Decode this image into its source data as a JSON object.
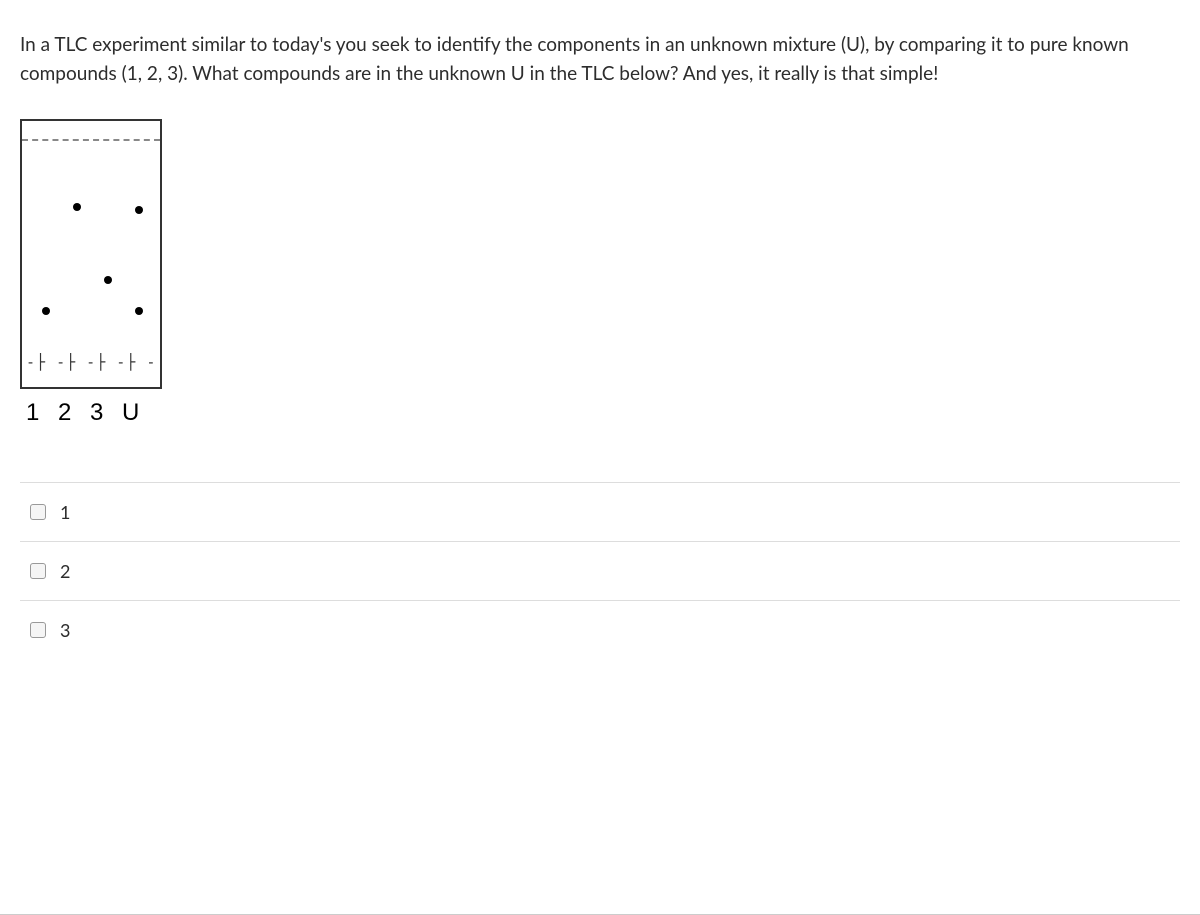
{
  "question": {
    "text": "In a TLC experiment similar to today's you seek to identify the components in an unknown mixture (U), by comparing it to pure known compounds (1, 2, 3).  What compounds are in the unknown U in the TLC below?  And yes, it really is that simple!"
  },
  "tlc": {
    "lane_labels": "1 2 3 U",
    "baseline_marks": "-├ -├ -├ -├ -",
    "spots": [
      {
        "lane": 1,
        "rf_position": "low"
      },
      {
        "lane": 2,
        "rf_position": "high"
      },
      {
        "lane": 3,
        "rf_position": "mid"
      },
      {
        "lane": "U",
        "rf_position": "high"
      },
      {
        "lane": "U",
        "rf_position": "low"
      }
    ]
  },
  "options": [
    {
      "label": "1",
      "checked": false
    },
    {
      "label": "2",
      "checked": false
    },
    {
      "label": "3",
      "checked": false
    }
  ]
}
